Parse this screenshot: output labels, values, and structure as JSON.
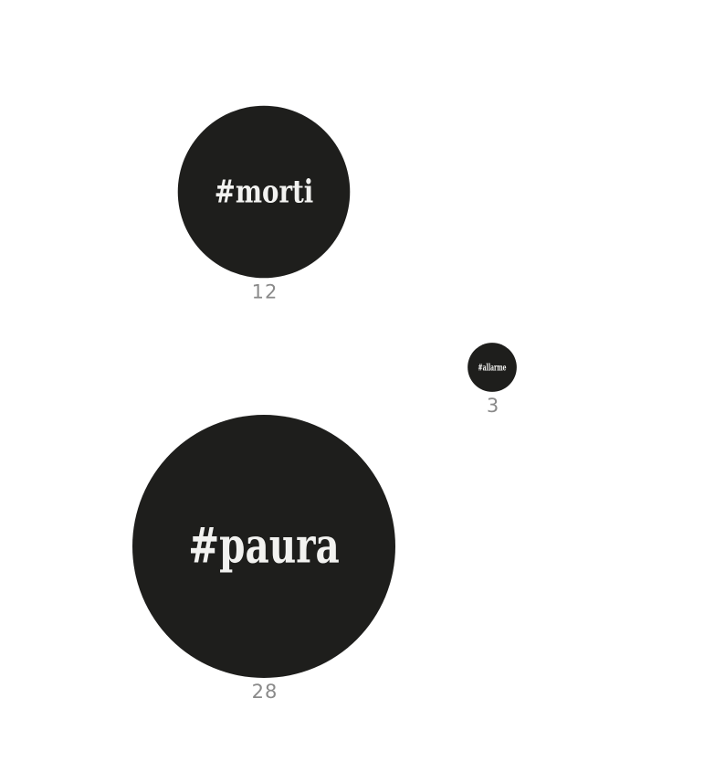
{
  "chart_data": {
    "type": "bubble",
    "title": "",
    "items": [
      {
        "tag": "#morti",
        "value": 12
      },
      {
        "tag": "#allarme",
        "value": 3
      },
      {
        "tag": "#paura",
        "value": 28
      }
    ]
  },
  "colors": {
    "bubble": "#1e1e1c",
    "tag_text": "#f2f2f0",
    "value_text": "#8a8a8a",
    "background": "#ffffff"
  }
}
